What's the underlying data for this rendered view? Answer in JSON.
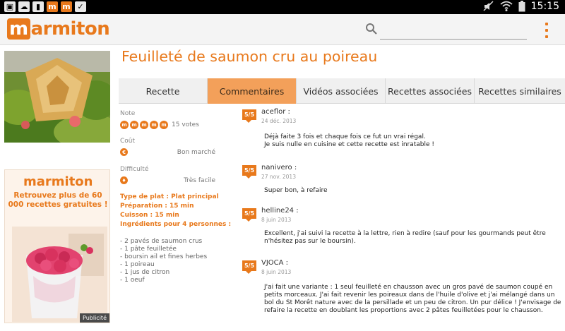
{
  "status_bar": {
    "time": "15:15",
    "icons": [
      "image-icon",
      "cloud-upload-icon",
      "sim-icon",
      "marmiton-notification-icon",
      "marmiton-notification-icon",
      "clipboard-check-icon"
    ],
    "right_icons": [
      "mute-icon",
      "wifi-icon",
      "battery-icon"
    ]
  },
  "app": {
    "logo": "marmiton",
    "search_placeholder": "",
    "accent_color": "#e8791c"
  },
  "recipe": {
    "title": "Feuilleté de saumon cru au poireau"
  },
  "tabs": [
    {
      "label": "Recette",
      "active": false
    },
    {
      "label": "Commentaires",
      "active": true
    },
    {
      "label": "Vidéos associées",
      "active": false
    },
    {
      "label": "Recettes associées",
      "active": false
    },
    {
      "label": "Recettes similaires",
      "active": false
    }
  ],
  "info": {
    "note_label": "Note",
    "rating_value": 5,
    "votes": "15 votes",
    "cout_label": "Coût",
    "cout_value": "Bon marché",
    "difficulte_label": "Difficulté",
    "difficulte_value": "Très facile",
    "specs": [
      "Type de plat : Plat principal",
      "Préparation : 15 min",
      "Cuisson : 15 min",
      "Ingrédients pour 4 personnes :"
    ],
    "ingredients": [
      "- 2 pavés de saumon crus",
      "- 1 pâte feuilletée",
      "- boursin ail et fines herbes",
      "- 1 poireau",
      "- 1 jus de citron",
      "- 1 oeuf"
    ]
  },
  "ad": {
    "brand": "marmiton",
    "text": "Retrouvez plus de 60 000 recettes gratuites !",
    "badge": "Publicité"
  },
  "comments": [
    {
      "rating": "5/5",
      "author": "aceflor :",
      "date": "24 déc. 2013",
      "lines": [
        "Déjà faite 3 fois et chaque fois ce fut un vrai régal.",
        "Je suis nulle en cuisine et cette recette est inratable !"
      ]
    },
    {
      "rating": "5/5",
      "author": "nanivero :",
      "date": "27 nov. 2013",
      "lines": [
        "Super bon, à refaire"
      ]
    },
    {
      "rating": "5/5",
      "author": "helline24 :",
      "date": "8 juin 2013",
      "lines": [
        "Excellent, j'ai suivi la recette à la lettre, rien à redire (sauf pour les gourmands peut être",
        "n'hésitez pas sur le boursin)."
      ]
    },
    {
      "rating": "5/5",
      "author": "VJOCA :",
      "date": "8 juin 2013",
      "lines": [
        "J'ai fait une variante : 1 seul feuilleté en chausson avec un gros pavé de saumon coupé en",
        "petits morceaux. J'ai fait revenir les poireaux dans de l'huile d'olive et j'ai mélangé dans un",
        "bol du St Morêt nature avec de la persillade et un peu de citron. Un pur délice ! J'envisage de",
        "refaire la recette en doublant les proportions avec 2 pâtes feuilletées pour le chausson."
      ]
    }
  ]
}
